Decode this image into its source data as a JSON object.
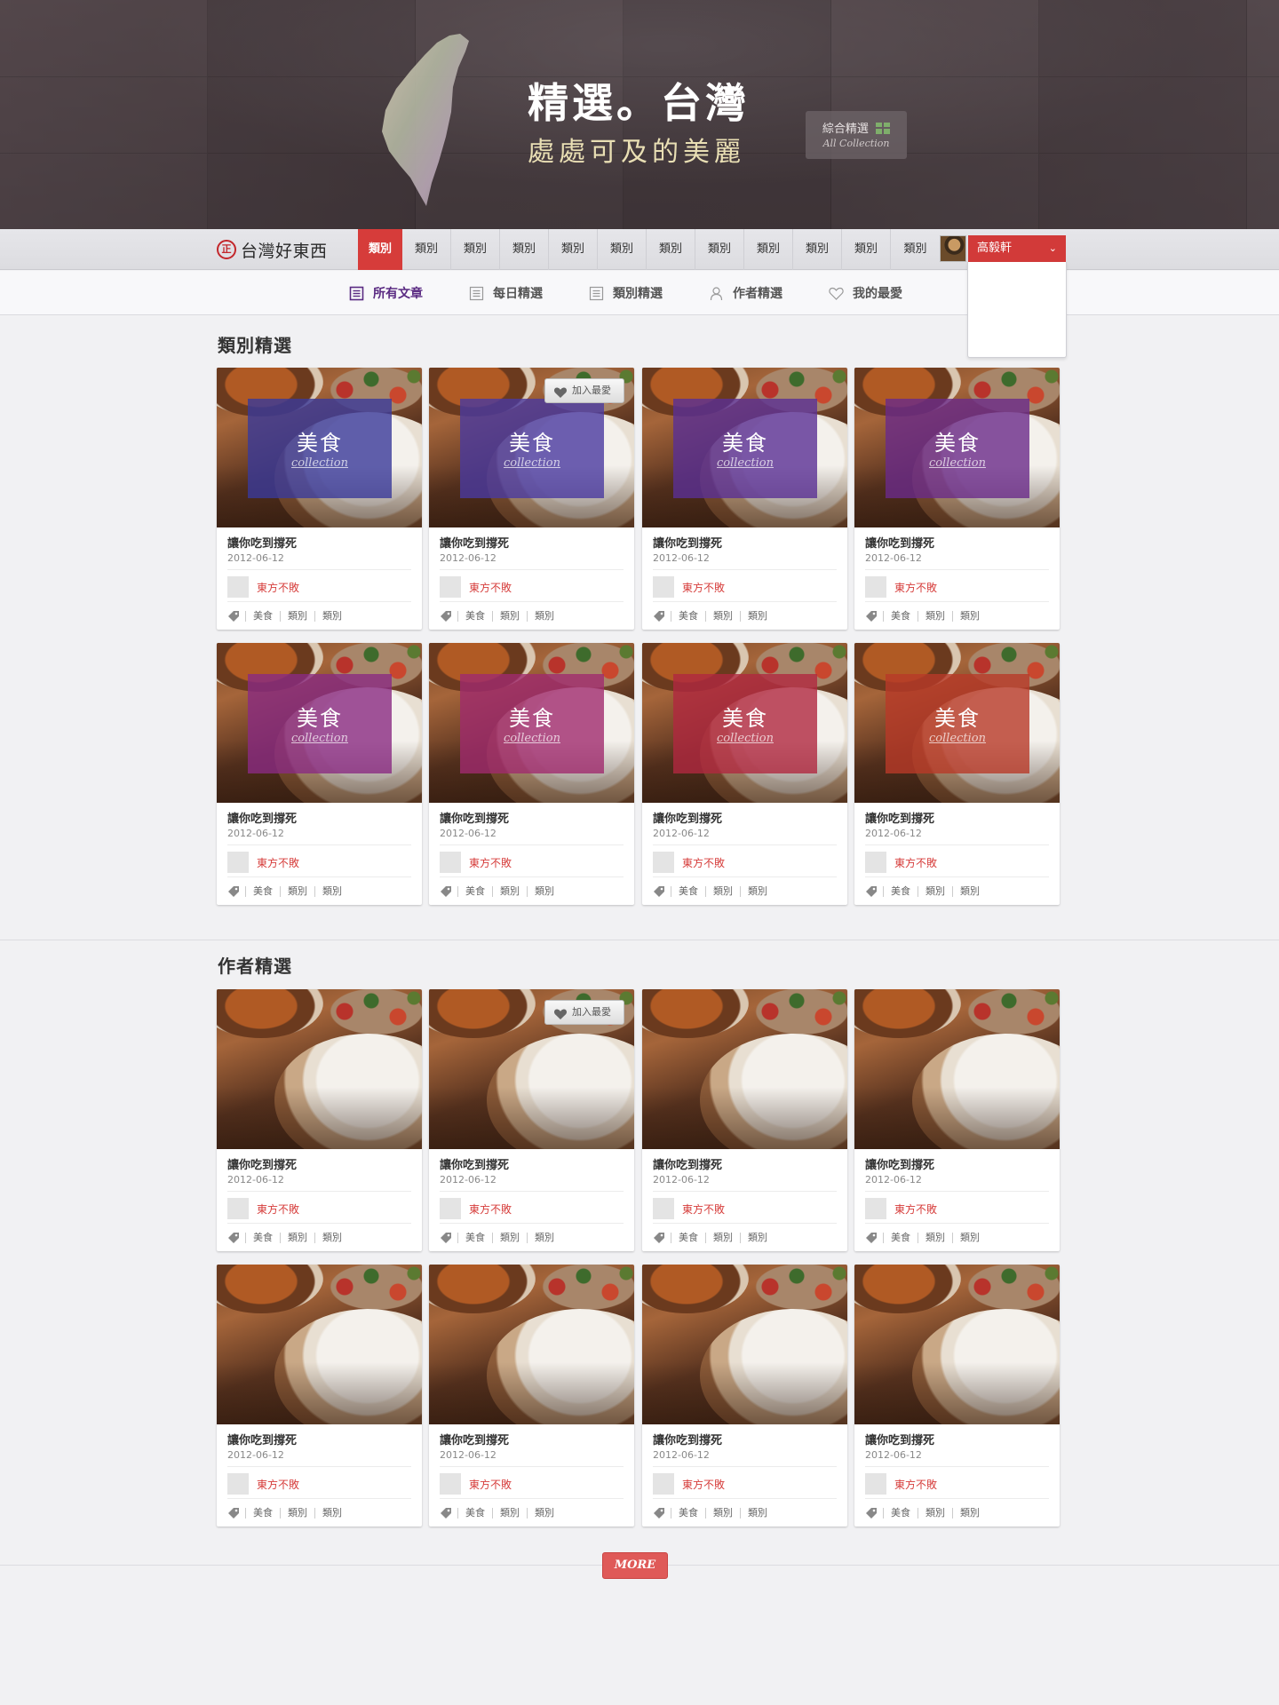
{
  "hero": {
    "title": "精選。台灣",
    "subtitle": "處處可及的美麗",
    "all_collection_label": "綜合精選",
    "all_collection_sub": "All Collection"
  },
  "topnav": {
    "logo_mark": "正",
    "logo_text": "台灣好東西",
    "items": [
      "類別",
      "類別",
      "類別",
      "類別",
      "類別",
      "類別",
      "類別",
      "類別",
      "類別",
      "類別",
      "類別",
      "類別"
    ],
    "user_name": "高毅軒"
  },
  "subnav": {
    "items": [
      {
        "label": "所有文章",
        "icon": "document-icon"
      },
      {
        "label": "每日精選",
        "icon": "list-icon"
      },
      {
        "label": "類別精選",
        "icon": "list-icon"
      },
      {
        "label": "作者精選",
        "icon": "person-icon"
      },
      {
        "label": "我的最愛",
        "icon": "heart-icon"
      }
    ]
  },
  "sections": [
    {
      "title": "類別精選"
    },
    {
      "title": "作者精選"
    }
  ],
  "card": {
    "title": "讓你吃到撐死",
    "date": "2012-06-12",
    "author": "東方不敗",
    "tags": [
      "美食",
      "類別",
      "類別"
    ],
    "overlay_title": "美食",
    "overlay_sub": "collection",
    "fav_label": "加入最愛"
  },
  "overlay_colors": [
    "#3a3a9a",
    "#4a3aa0",
    "#5a3095",
    "#6a2a8a",
    "#8a2a82",
    "#a02a6e",
    "#b02840",
    "#b83a28"
  ],
  "more_label": "MORE",
  "colors": {
    "accent": "#d63c3a",
    "subnav_active": "#5a2a82",
    "hero_subtitle": "#e9dfb4"
  }
}
